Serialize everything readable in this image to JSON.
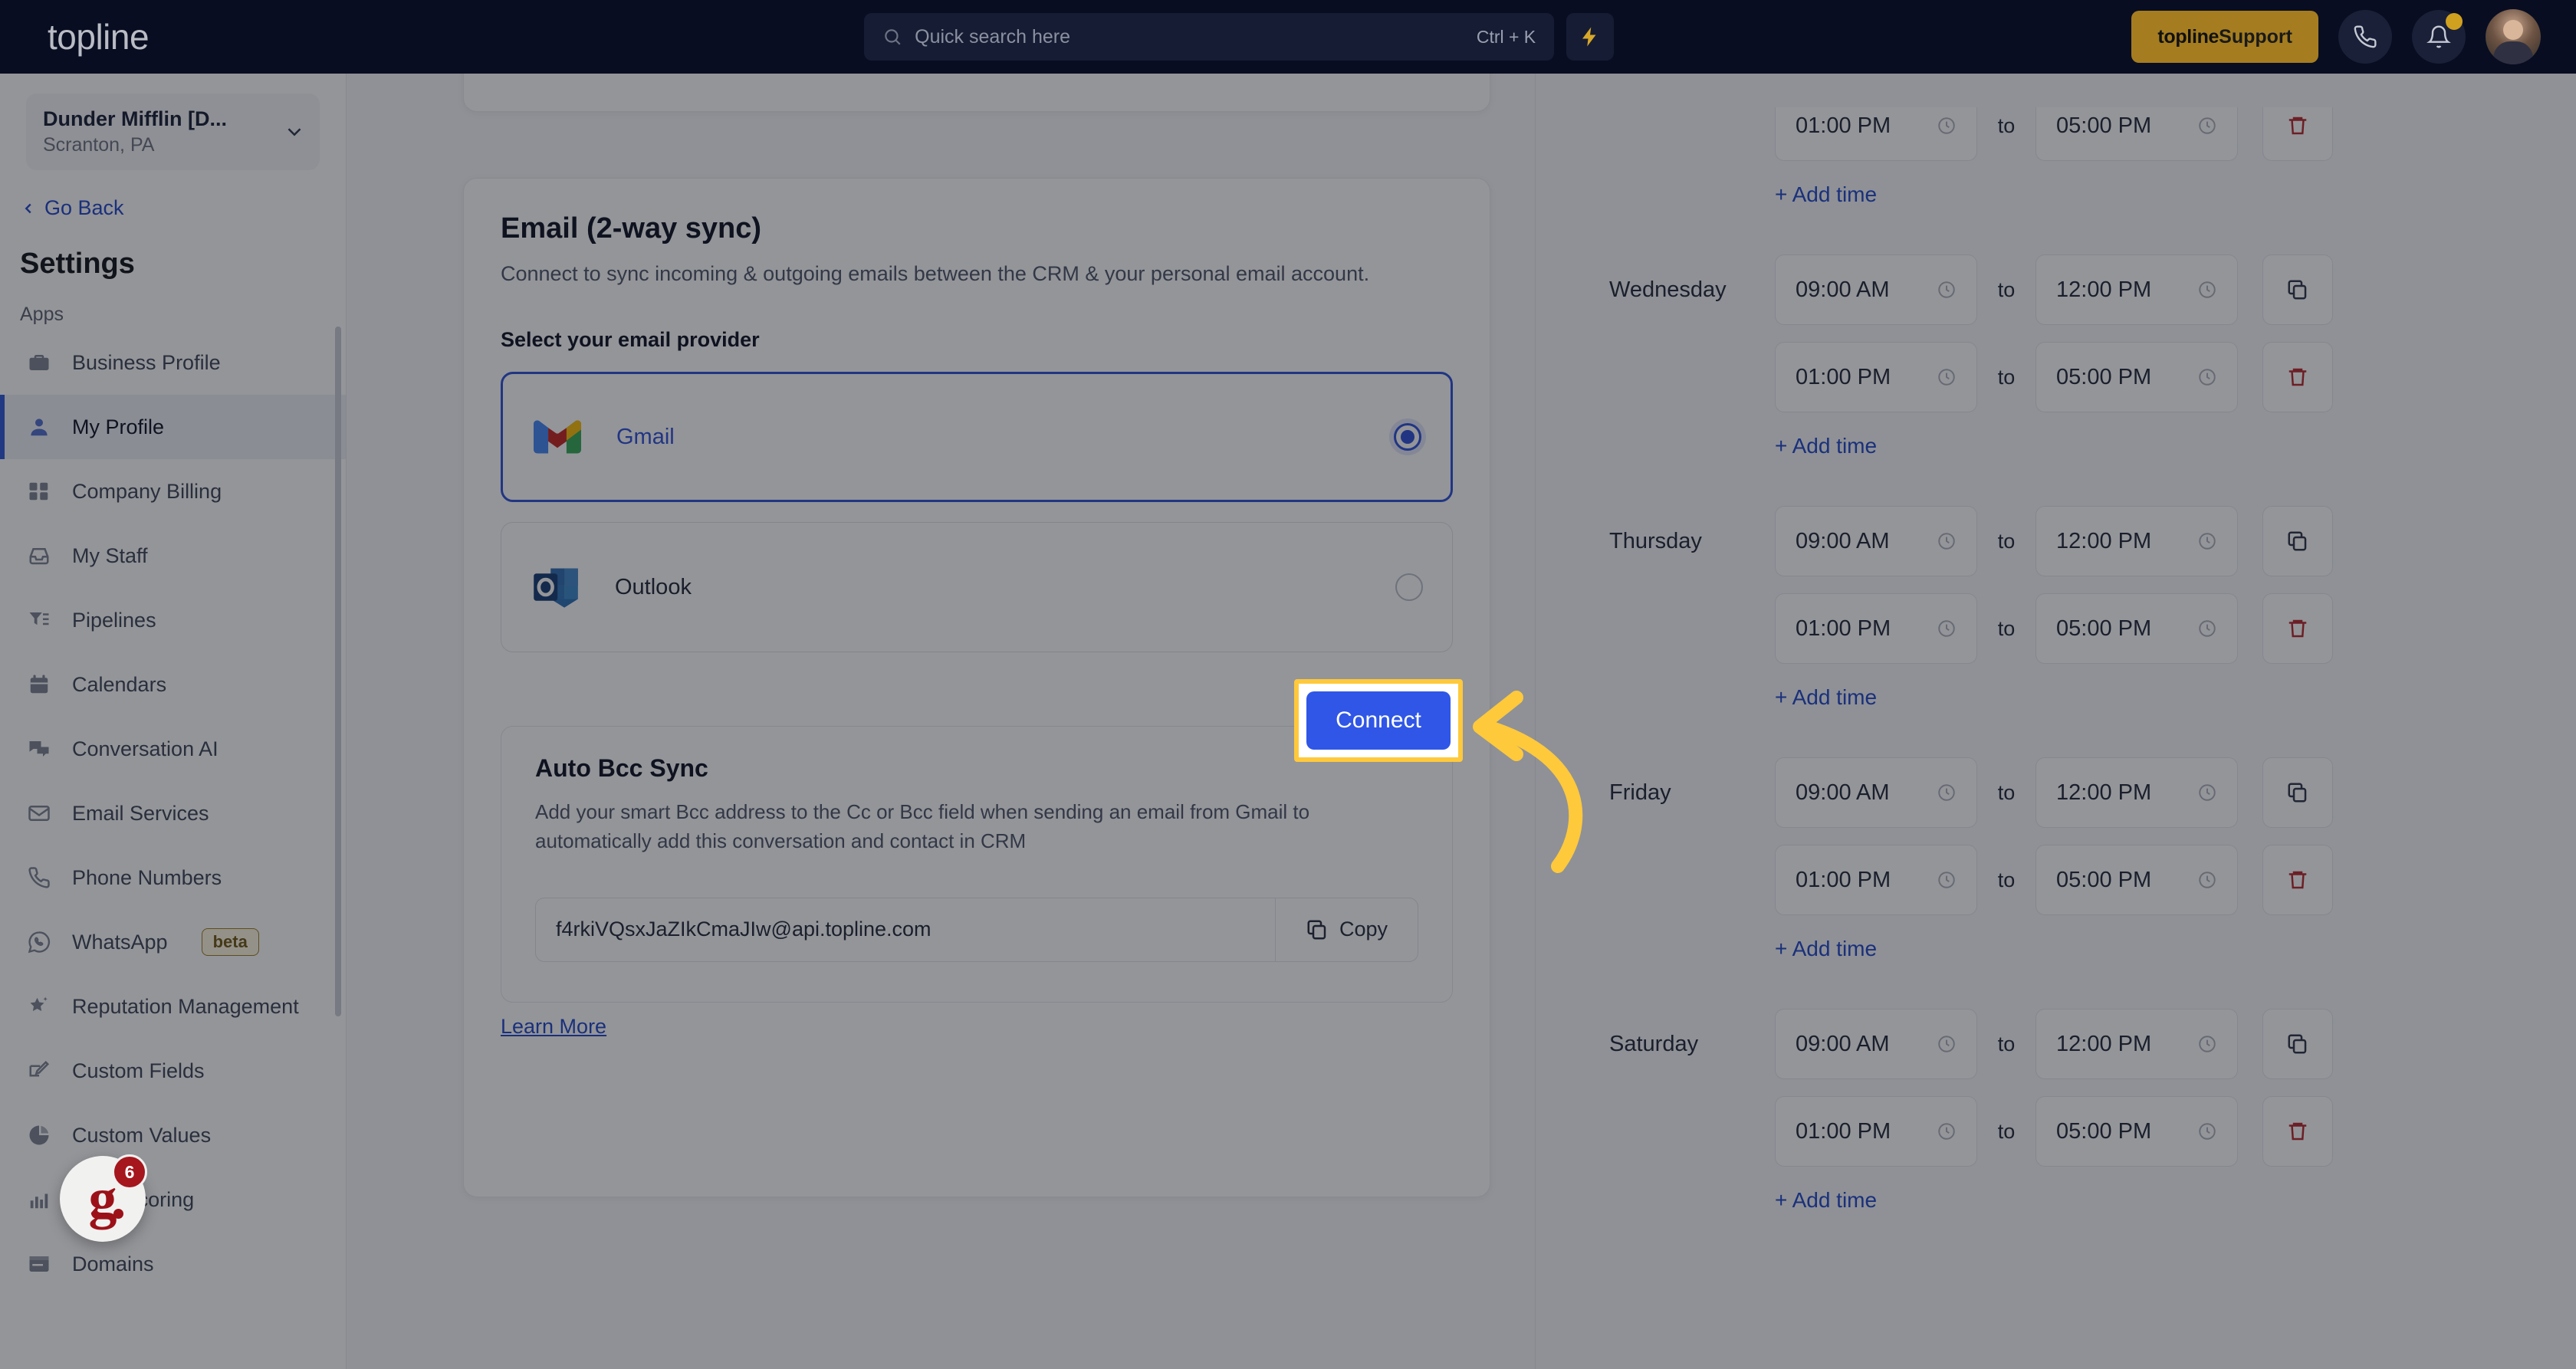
{
  "topbar": {
    "logo": "topline",
    "search": {
      "placeholder": "Quick search here",
      "shortcut": "Ctrl + K",
      "icon": "search-icon"
    },
    "bolt_icon": "lightning-bolt-icon",
    "support_button": {
      "brand": "topline",
      "label": " Support"
    },
    "phone_icon": "phone-icon",
    "bell_icon": "bell-icon",
    "avatar": "user-avatar"
  },
  "sidebar": {
    "org": {
      "name": "Dunder Mifflin [D...",
      "location": "Scranton, PA",
      "chevron": "chevron-down-icon"
    },
    "go_back": "Go Back",
    "title": "Settings",
    "group_label": "Apps",
    "items": [
      {
        "label": "Business Profile",
        "icon": "briefcase-icon",
        "active": false
      },
      {
        "label": "My Profile",
        "icon": "person-icon",
        "active": true
      },
      {
        "label": "Company Billing",
        "icon": "calculator-icon",
        "active": false
      },
      {
        "label": "My Staff",
        "icon": "inbox-icon",
        "active": false
      },
      {
        "label": "Pipelines",
        "icon": "funnel-icon",
        "active": false
      },
      {
        "label": "Calendars",
        "icon": "calendar-icon",
        "active": false
      },
      {
        "label": "Conversation AI",
        "icon": "chat-bubbles-icon",
        "active": false
      },
      {
        "label": "Email Services",
        "icon": "envelope-icon",
        "active": false
      },
      {
        "label": "Phone Numbers",
        "icon": "phone-icon",
        "active": false
      },
      {
        "label": "WhatsApp",
        "icon": "whatsapp-icon",
        "badge": "beta",
        "active": false
      },
      {
        "label": "Reputation Management",
        "icon": "star-sparkle-icon",
        "active": false
      },
      {
        "label": "Custom Fields",
        "icon": "pencil-field-icon",
        "active": false
      },
      {
        "label": "Custom Values",
        "icon": "pie-chart-icon",
        "active": false
      },
      {
        "label": "Lead Scoring",
        "icon": "chart-bars-icon",
        "active": false
      },
      {
        "label": "Domains",
        "icon": "browser-window-icon",
        "active": false
      }
    ],
    "floating_widget": {
      "mark": "g",
      "badge_count": "6"
    }
  },
  "email_card": {
    "title": "Email (2-way sync)",
    "description": "Connect to sync incoming & outgoing emails between the CRM & your personal email account.",
    "provider_label": "Select your email provider",
    "providers": [
      {
        "name": "Gmail",
        "icon": "gmail-logo",
        "selected": true
      },
      {
        "name": "Outlook",
        "icon": "outlook-logo",
        "selected": false
      }
    ],
    "connect_button": "Connect",
    "auto_bcc": {
      "title": "Auto Bcc Sync",
      "description": "Add your smart Bcc address to the Cc or Bcc field when sending an email from Gmail to automatically add this conversation and contact in CRM",
      "address": "f4rkiVQsxJaZIkCmaJIw@api.topline.com",
      "copy_label": "Copy",
      "copy_icon": "copy-icon"
    },
    "learn_more": "Learn More"
  },
  "schedule": {
    "to_label": "to",
    "add_time_label": "+ Add time",
    "copy_icon": "copy-icon",
    "delete_icon": "trash-icon",
    "clock_icon": "clock-icon",
    "partial_top_row": {
      "start": "01:00 PM",
      "end": "05:00 PM"
    },
    "days": [
      {
        "day": "Wednesday",
        "rows": [
          {
            "start": "09:00 AM",
            "end": "12:00 PM",
            "action": "copy"
          },
          {
            "start": "01:00 PM",
            "end": "05:00 PM",
            "action": "delete"
          }
        ]
      },
      {
        "day": "Thursday",
        "rows": [
          {
            "start": "09:00 AM",
            "end": "12:00 PM",
            "action": "copy"
          },
          {
            "start": "01:00 PM",
            "end": "05:00 PM",
            "action": "delete"
          }
        ]
      },
      {
        "day": "Friday",
        "rows": [
          {
            "start": "09:00 AM",
            "end": "12:00 PM",
            "action": "copy"
          },
          {
            "start": "01:00 PM",
            "end": "05:00 PM",
            "action": "delete"
          }
        ]
      },
      {
        "day": "Saturday",
        "rows": [
          {
            "start": "09:00 AM",
            "end": "12:00 PM",
            "action": "copy"
          },
          {
            "start": "01:00 PM",
            "end": "05:00 PM",
            "action": "delete"
          }
        ]
      }
    ]
  },
  "annotation": {
    "highlight_color": "#ffc93c",
    "arrow": "curved-arrow-pointing-left"
  },
  "colors": {
    "topbar_bg": "#080d21",
    "accent_blue": "#2f56e6",
    "link_blue": "#1e45c8",
    "support_gold": "#a57d20",
    "danger_red": "#b3262a",
    "highlight_yellow": "#ffc93c"
  }
}
